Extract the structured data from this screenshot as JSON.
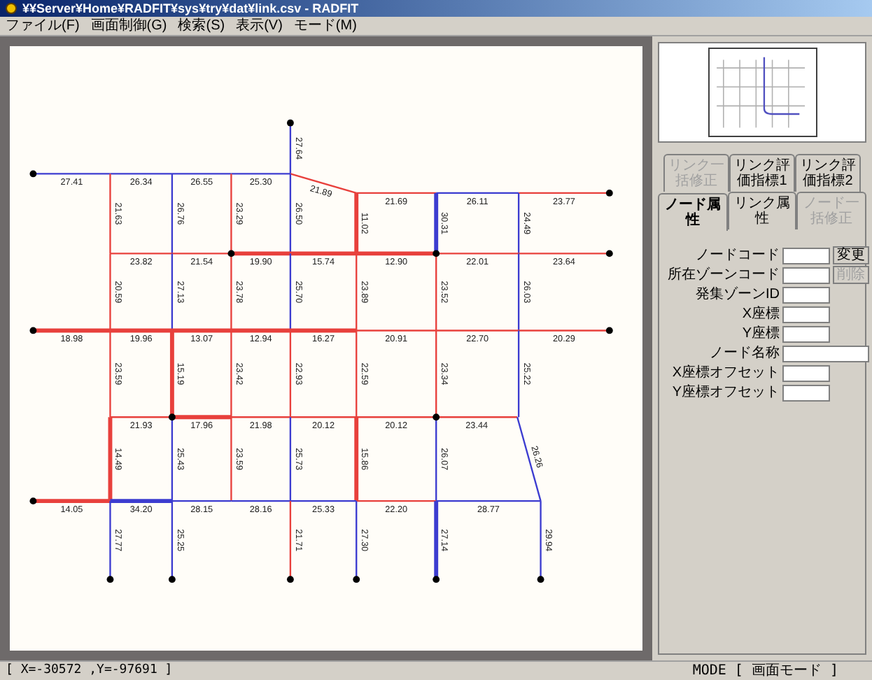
{
  "window": {
    "title": "¥¥Server¥Home¥RADFIT¥sys¥try¥dat¥link.csv - RADFIT"
  },
  "menu": [
    "ファイル(F)",
    "画面制御(G)",
    "検索(S)",
    "表示(V)",
    "モード(M)"
  ],
  "links": [
    {
      "label": "27.41",
      "color": "#3c3cd0",
      "heavy": false
    },
    {
      "label": "26.34",
      "color": "#3c3cd0",
      "heavy": false
    },
    {
      "label": "26.55",
      "color": "#3c3cd0",
      "heavy": false
    },
    {
      "label": "25.30",
      "color": "#3c3cd0",
      "heavy": false
    },
    {
      "label": "27.64",
      "color": "#3c3cd0",
      "heavy": false
    },
    {
      "label": "21.89",
      "color": "#e8403c",
      "heavy": false
    },
    {
      "label": "21.69",
      "color": "#e8403c",
      "heavy": false
    },
    {
      "label": "26.11",
      "color": "#3c3cd0",
      "heavy": false
    },
    {
      "label": "23.77",
      "color": "#e8403c",
      "heavy": false
    },
    {
      "label": "21.63",
      "color": "#e8403c",
      "heavy": false
    },
    {
      "label": "26.76",
      "color": "#3c3cd0",
      "heavy": false
    },
    {
      "label": "23.29",
      "color": "#e8403c",
      "heavy": false
    },
    {
      "label": "26.50",
      "color": "#3c3cd0",
      "heavy": false
    },
    {
      "label": "11.02",
      "color": "#e8403c",
      "heavy": true
    },
    {
      "label": "30.31",
      "color": "#3c3cd0",
      "heavy": true
    },
    {
      "label": "24.49",
      "color": "#3c3cd0",
      "heavy": false
    },
    {
      "label": "23.82",
      "color": "#e8403c",
      "heavy": false
    },
    {
      "label": "21.54",
      "color": "#e8403c",
      "heavy": false
    },
    {
      "label": "19.90",
      "color": "#e8403c",
      "heavy": true
    },
    {
      "label": "15.74",
      "color": "#e8403c",
      "heavy": true
    },
    {
      "label": "12.90",
      "color": "#e8403c",
      "heavy": true
    },
    {
      "label": "22.01",
      "color": "#e8403c",
      "heavy": false
    },
    {
      "label": "23.64",
      "color": "#e8403c",
      "heavy": false
    },
    {
      "label": "20.59",
      "color": "#e8403c",
      "heavy": false
    },
    {
      "label": "27.13",
      "color": "#3c3cd0",
      "heavy": false
    },
    {
      "label": "23.78",
      "color": "#e8403c",
      "heavy": false
    },
    {
      "label": "25.70",
      "color": "#3c3cd0",
      "heavy": false
    },
    {
      "label": "23.89",
      "color": "#e8403c",
      "heavy": false
    },
    {
      "label": "23.52",
      "color": "#e8403c",
      "heavy": false
    },
    {
      "label": "26.03",
      "color": "#3c3cd0",
      "heavy": false
    },
    {
      "label": "18.98",
      "color": "#e8403c",
      "heavy": true
    },
    {
      "label": "19.96",
      "color": "#e8403c",
      "heavy": true
    },
    {
      "label": "13.07",
      "color": "#e8403c",
      "heavy": true
    },
    {
      "label": "12.94",
      "color": "#e8403c",
      "heavy": true
    },
    {
      "label": "16.27",
      "color": "#e8403c",
      "heavy": true
    },
    {
      "label": "20.91",
      "color": "#e8403c",
      "heavy": false
    },
    {
      "label": "22.70",
      "color": "#e8403c",
      "heavy": false
    },
    {
      "label": "20.29",
      "color": "#e8403c",
      "heavy": false
    },
    {
      "label": "23.59",
      "color": "#e8403c",
      "heavy": false
    },
    {
      "label": "15.19",
      "color": "#e8403c",
      "heavy": true
    },
    {
      "label": "23.42",
      "color": "#e8403c",
      "heavy": false
    },
    {
      "label": "22.93",
      "color": "#e8403c",
      "heavy": false
    },
    {
      "label": "22.59",
      "color": "#e8403c",
      "heavy": false
    },
    {
      "label": "23.34",
      "color": "#e8403c",
      "heavy": false
    },
    {
      "label": "25.22",
      "color": "#3c3cd0",
      "heavy": false
    },
    {
      "label": "21.93",
      "color": "#e8403c",
      "heavy": false
    },
    {
      "label": "17.96",
      "color": "#e8403c",
      "heavy": true
    },
    {
      "label": "21.98",
      "color": "#e8403c",
      "heavy": false
    },
    {
      "label": "20.12",
      "color": "#e8403c",
      "heavy": false
    },
    {
      "label": "20.12",
      "color": "#e8403c",
      "heavy": false
    },
    {
      "label": "23.44",
      "color": "#e8403c",
      "heavy": false
    },
    {
      "label": "14.49",
      "color": "#e8403c",
      "heavy": true
    },
    {
      "label": "25.43",
      "color": "#3c3cd0",
      "heavy": false
    },
    {
      "label": "23.59",
      "color": "#e8403c",
      "heavy": false
    },
    {
      "label": "25.73",
      "color": "#3c3cd0",
      "heavy": false
    },
    {
      "label": "15.86",
      "color": "#e8403c",
      "heavy": true
    },
    {
      "label": "26.07",
      "color": "#3c3cd0",
      "heavy": false
    },
    {
      "label": "26.26",
      "color": "#3c3cd0",
      "heavy": false
    },
    {
      "label": "14.05",
      "color": "#e8403c",
      "heavy": true
    },
    {
      "label": "34.20",
      "color": "#3c3cd0",
      "heavy": true
    },
    {
      "label": "28.15",
      "color": "#3c3cd0",
      "heavy": false
    },
    {
      "label": "28.16",
      "color": "#3c3cd0",
      "heavy": false
    },
    {
      "label": "25.33",
      "color": "#3c3cd0",
      "heavy": false
    },
    {
      "label": "22.20",
      "color": "#e8403c",
      "heavy": false
    },
    {
      "label": "28.77",
      "color": "#3c3cd0",
      "heavy": false
    },
    {
      "label": "27.77",
      "color": "#3c3cd0",
      "heavy": false
    },
    {
      "label": "25.25",
      "color": "#3c3cd0",
      "heavy": false
    },
    {
      "label": "21.71",
      "color": "#e8403c",
      "heavy": false
    },
    {
      "label": "27.30",
      "color": "#3c3cd0",
      "heavy": false
    },
    {
      "label": "27.14",
      "color": "#3c3cd0",
      "heavy": true
    },
    {
      "label": "29.94",
      "color": "#3c3cd0",
      "heavy": false
    }
  ],
  "tab_rows": [
    [
      {
        "label": "リンク一括修正",
        "selected": false,
        "disabled": true
      },
      {
        "label": "リンク評価指標1",
        "selected": false,
        "disabled": false
      },
      {
        "label": "リンク評価指標2",
        "selected": false,
        "disabled": false
      }
    ],
    [
      {
        "label": "ノード属性",
        "selected": true,
        "disabled": false
      },
      {
        "label": "リンク属性",
        "selected": false,
        "disabled": false
      },
      {
        "label": "ノード一括修正",
        "selected": false,
        "disabled": true
      }
    ]
  ],
  "fields": [
    {
      "label": "ノードコード",
      "kind": "short"
    },
    {
      "label": "所在ゾーンコード",
      "kind": "short"
    },
    {
      "label": "発集ゾーンID",
      "kind": "short"
    },
    {
      "label": "X座標",
      "kind": "short"
    },
    {
      "label": "Y座標",
      "kind": "short"
    },
    {
      "label": "ノード名称",
      "kind": "long"
    },
    {
      "label": "X座標オフセット",
      "kind": "short"
    },
    {
      "label": "Y座標オフセット",
      "kind": "short"
    }
  ],
  "buttons": [
    {
      "label": "変更",
      "disabled": false
    },
    {
      "label": "削除",
      "disabled": true
    }
  ],
  "status_bar": {
    "coordinates": "[ X=-30572 ,Y=-97691 ]",
    "mode": "MODE [ 画面モード ]"
  }
}
